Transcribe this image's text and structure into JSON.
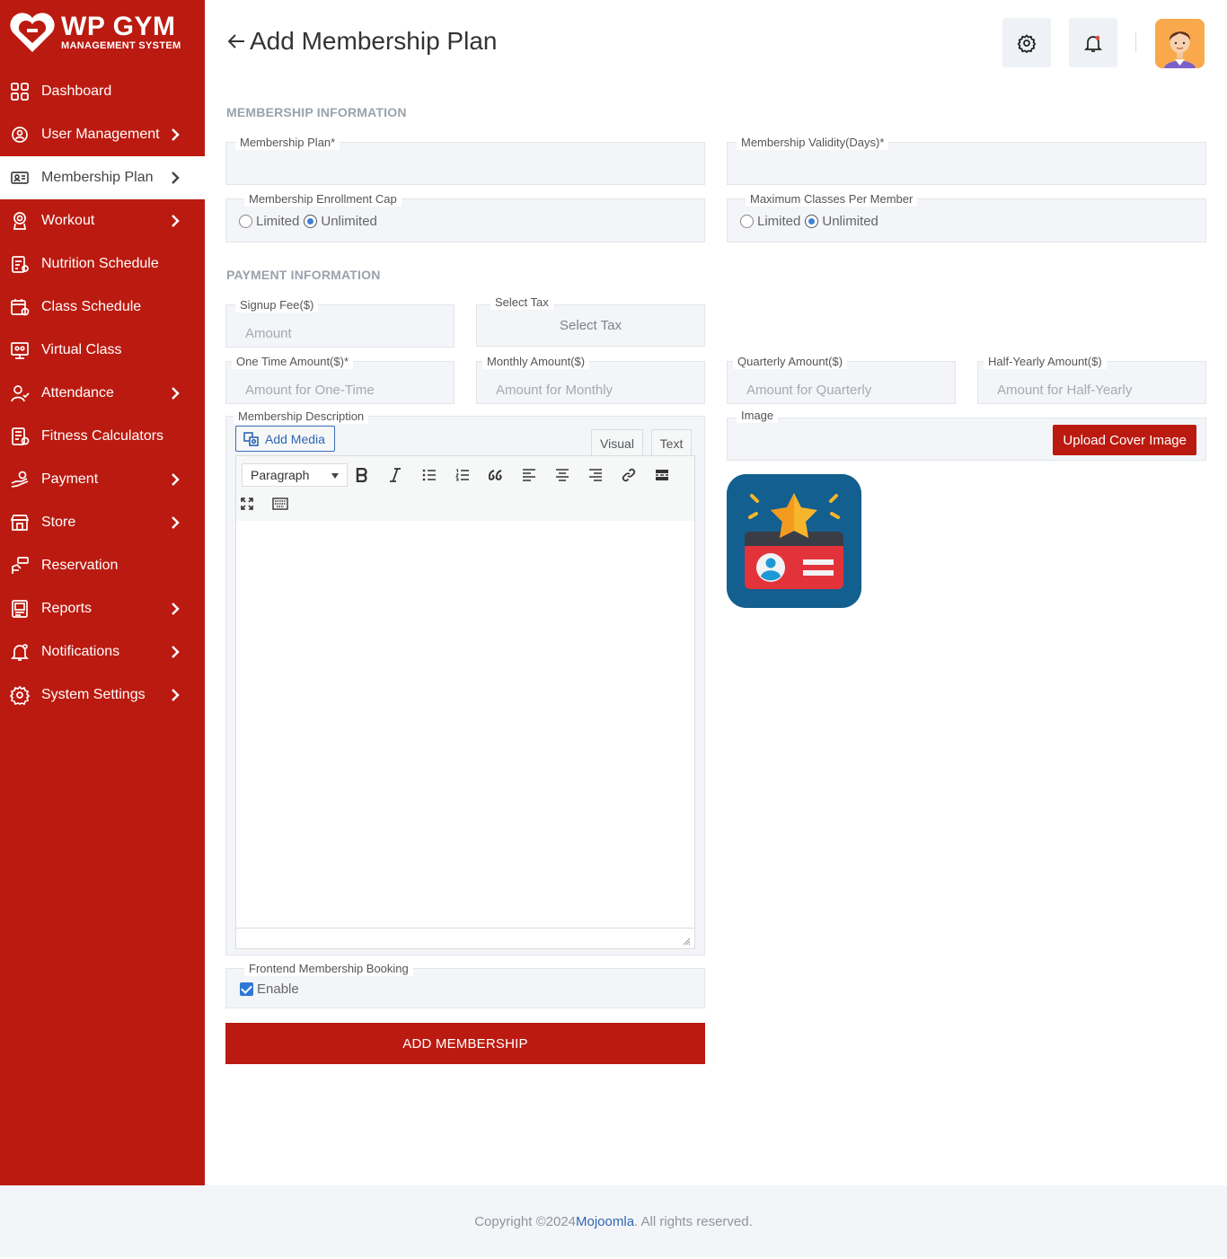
{
  "brand": {
    "title": "WP GYM",
    "subtitle": "MANAGEMENT SYSTEM"
  },
  "sidebar": {
    "items": [
      {
        "label": "Dashboard",
        "icon": "dashboard-grid-icon",
        "has_arrow": false
      },
      {
        "label": "User Management",
        "icon": "users-gear-icon",
        "has_arrow": true
      },
      {
        "label": "Membership Plan",
        "icon": "membership-card-icon",
        "has_arrow": true,
        "active": true
      },
      {
        "label": "Workout",
        "icon": "workout-icon",
        "has_arrow": true
      },
      {
        "label": "Nutrition Schedule",
        "icon": "nutrition-clipboard-icon",
        "has_arrow": false
      },
      {
        "label": "Class Schedule",
        "icon": "calendar-icon",
        "has_arrow": false
      },
      {
        "label": "Virtual Class",
        "icon": "virtual-class-icon",
        "has_arrow": false
      },
      {
        "label": "Attendance",
        "icon": "attendance-user-icon",
        "has_arrow": true
      },
      {
        "label": "Fitness Calculators",
        "icon": "calculator-icon",
        "has_arrow": false
      },
      {
        "label": "Payment",
        "icon": "payment-hand-icon",
        "has_arrow": true
      },
      {
        "label": "Store",
        "icon": "store-icon",
        "has_arrow": true
      },
      {
        "label": "Reservation",
        "icon": "reservation-icon",
        "has_arrow": false
      },
      {
        "label": "Reports",
        "icon": "reports-icon",
        "has_arrow": true
      },
      {
        "label": "Notifications",
        "icon": "bell-icon",
        "has_arrow": true
      },
      {
        "label": "System Settings",
        "icon": "gear-icon",
        "has_arrow": true
      }
    ]
  },
  "header": {
    "title": "Add Membership Plan"
  },
  "sections": {
    "membership_info": "MEMBERSHIP INFORMATION",
    "payment_info": "PAYMENT INFORMATION"
  },
  "form": {
    "membership_plan": {
      "label": "Membership Plan*",
      "value": ""
    },
    "validity": {
      "label": "Membership Validity(Days)*",
      "value": ""
    },
    "enrollment_cap": {
      "label": "Membership Enrollment Cap",
      "options": [
        "Limited",
        "Unlimited"
      ],
      "selected": "Unlimited"
    },
    "max_classes": {
      "label": "Maximum Classes Per Member",
      "options": [
        "Limited",
        "Unlimited"
      ],
      "selected": "Unlimited"
    },
    "signup_fee": {
      "label": "Signup Fee($)",
      "placeholder": "Amount"
    },
    "select_tax": {
      "label": "Select Tax",
      "value": "Select Tax"
    },
    "one_time": {
      "label": "One Time Amount($)*",
      "placeholder": "Amount for One-Time"
    },
    "monthly": {
      "label": "Monthly Amount($)",
      "placeholder": "Amount for Monthly"
    },
    "quarterly": {
      "label": "Quarterly Amount($)",
      "placeholder": "Amount for Quarterly"
    },
    "half_yearly": {
      "label": "Half-Yearly Amount($)",
      "placeholder": "Amount for Half-Yearly"
    },
    "description": {
      "label": "Membership Description",
      "add_media": "Add Media",
      "tab_visual": "Visual",
      "tab_text": "Text",
      "format": "Paragraph"
    },
    "image": {
      "label": "Image",
      "upload_button": "Upload Cover Image"
    },
    "frontend_booking": {
      "label": "Frontend Membership Booking",
      "checkbox_label": "Enable",
      "checked": true
    },
    "submit": "ADD MEMBERSHIP"
  },
  "footer": {
    "prefix": "Copyright ©2024 ",
    "brand": "Mojoomla",
    "suffix": ". All rights reserved."
  },
  "colors": {
    "accent": "#bb1a10",
    "link": "#2f66b3",
    "field_bg": "#f3f5f8"
  }
}
